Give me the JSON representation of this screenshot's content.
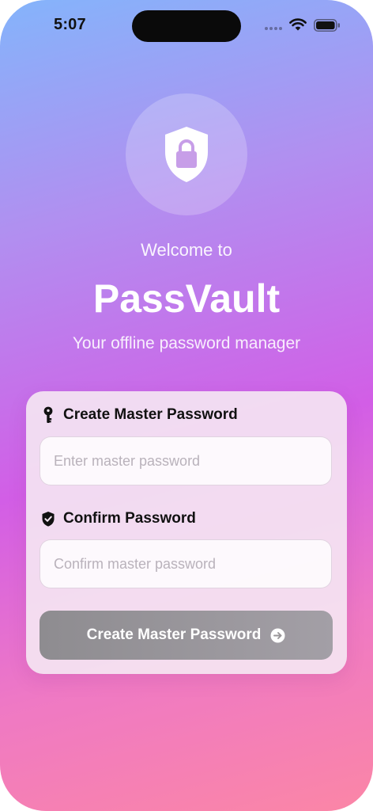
{
  "status_bar": {
    "time": "5:07"
  },
  "hero": {
    "logo_icon": "shield-lock-icon",
    "welcome": "Welcome to",
    "app_name": "PassVault",
    "tagline": "Your offline password manager"
  },
  "form": {
    "master": {
      "label": "Create Master Password",
      "icon": "key-icon",
      "value": "",
      "placeholder": "Enter master password"
    },
    "confirm": {
      "label": "Confirm Password",
      "icon": "shield-check-icon",
      "value": "",
      "placeholder": "Confirm master password"
    },
    "submit": {
      "label": "Create Master Password",
      "icon": "arrow-right-circle-icon",
      "enabled": false
    }
  },
  "colors": {
    "gradient_top": "#84b4fb",
    "gradient_mid": "#d25ee6",
    "gradient_bottom": "#fb86a6",
    "button_disabled": "#9a979d"
  }
}
